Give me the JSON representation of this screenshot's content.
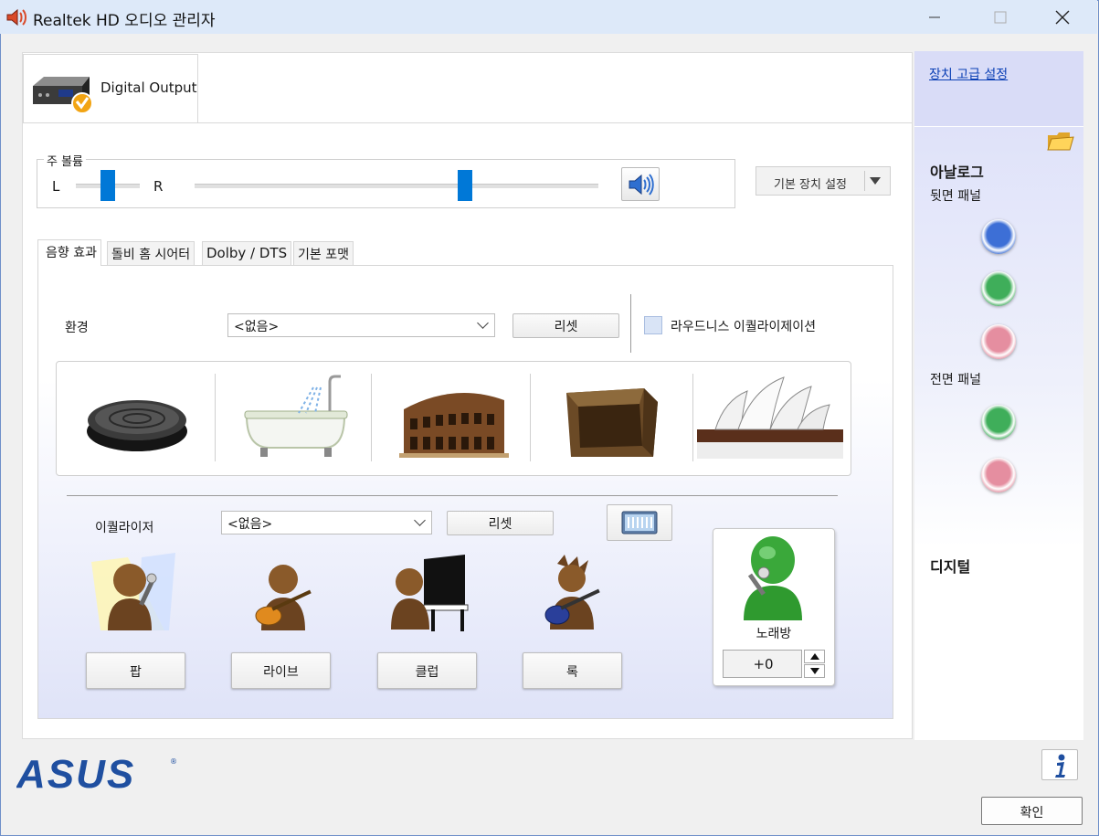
{
  "window": {
    "title": "Realtek HD 오디오 관리자"
  },
  "device_tab": {
    "label": "Digital Output"
  },
  "volume": {
    "group_label": "주 볼륨",
    "left_label": "L",
    "right_label": "R",
    "balance_level": 0.5,
    "master_level": 0.67
  },
  "default_device": {
    "label": "기본 장치 설정"
  },
  "tabs": [
    {
      "label": "음향 효과"
    },
    {
      "label": "돌비 홈 시어터"
    },
    {
      "label": "Dolby / DTS"
    },
    {
      "label": "기본 포맷"
    }
  ],
  "environment": {
    "label": "환경",
    "selected": "<없음>",
    "reset_label": "리셋",
    "loudness_label": "라우드니스 이퀄라이제이션",
    "loudness_checked": false,
    "presets": [
      "stone-disc-icon",
      "bathtub-icon",
      "colosseum-icon",
      "stone-room-icon",
      "opera-house-icon"
    ]
  },
  "equalizer": {
    "label": "이퀄라이저",
    "selected": "<없음>",
    "reset_label": "리셋",
    "presets": [
      {
        "label": "팝",
        "icon": "singer-icon"
      },
      {
        "label": "라이브",
        "icon": "guitarist-icon"
      },
      {
        "label": "클럽",
        "icon": "pianist-icon"
      },
      {
        "label": "록",
        "icon": "rock-guitarist-icon"
      }
    ]
  },
  "karaoke": {
    "label": "노래방",
    "value": "+0"
  },
  "right_panel": {
    "advanced_link": "장치 고급 설정",
    "analog_label": "아날로그",
    "rear_panel_label": "뒷면 패널",
    "front_panel_label": "전면 패널",
    "digital_label": "디지털",
    "rear_jacks": [
      "#3d6fd6",
      "#3fae5a",
      "#e58ea0"
    ],
    "front_jacks": [
      "#3fae5a",
      "#e58ea0"
    ]
  },
  "footer": {
    "ok_label": "확인",
    "logo_text": "ASUS"
  }
}
